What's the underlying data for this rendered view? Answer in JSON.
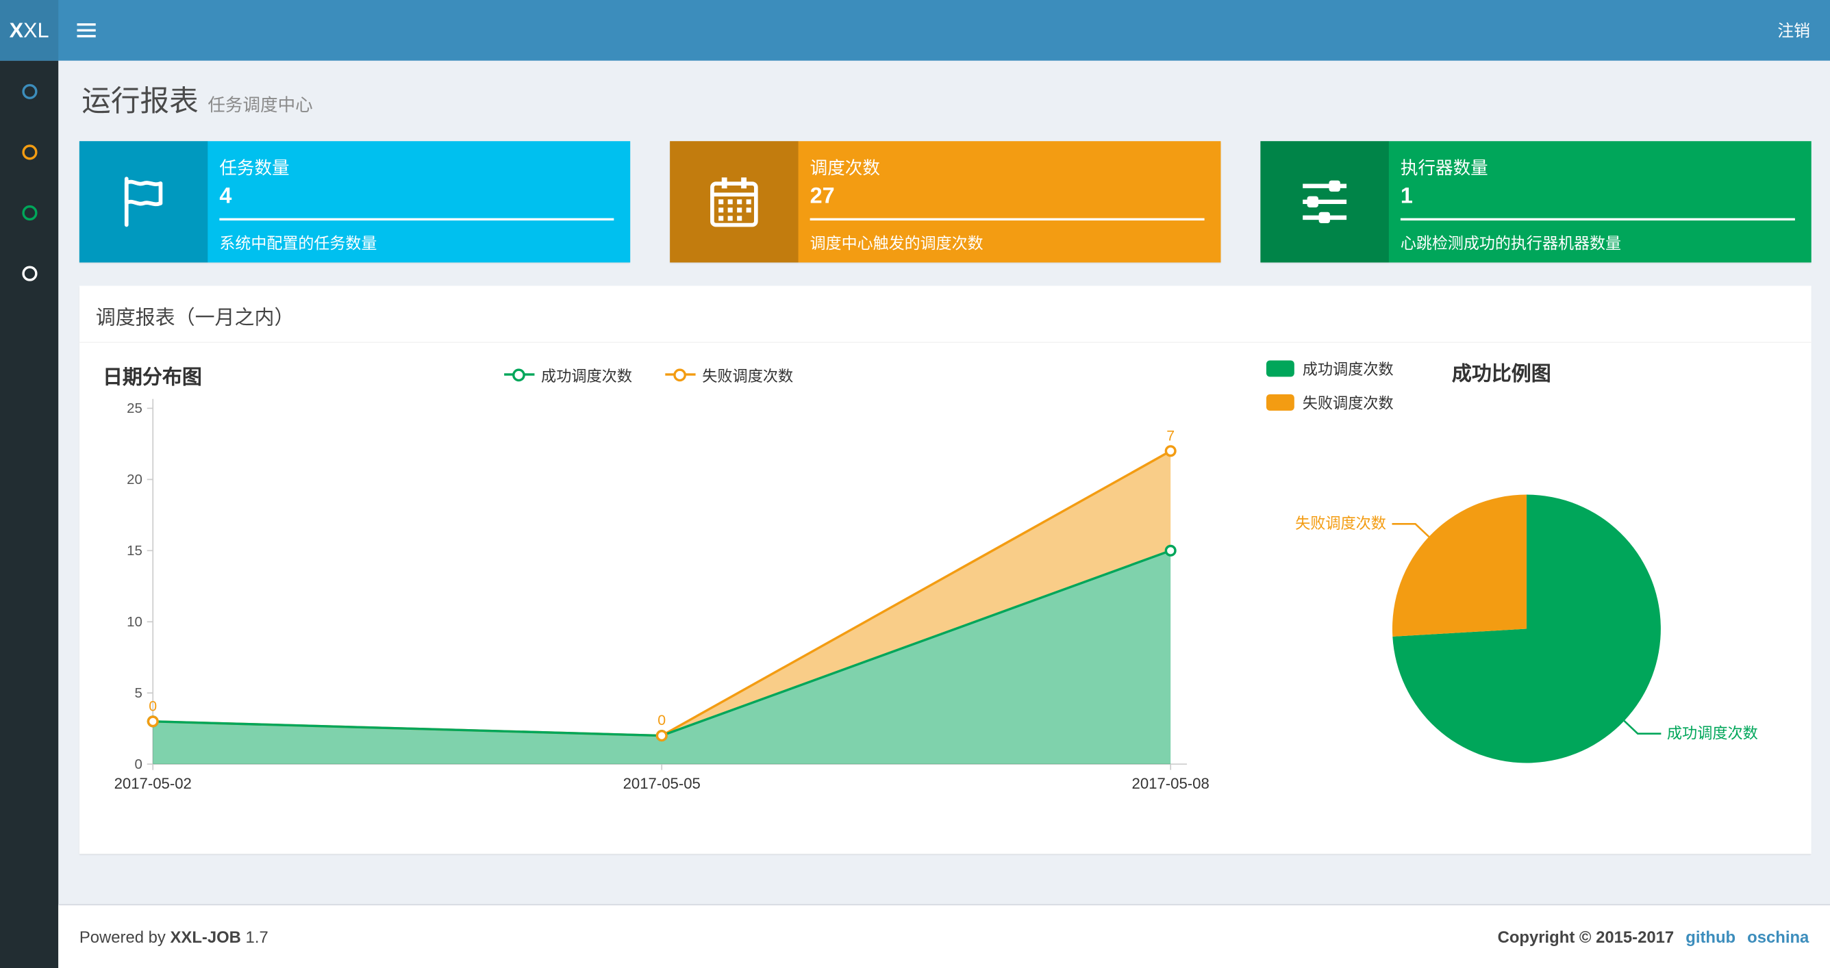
{
  "navbar": {
    "logo_bold": "X",
    "logo_rest": "XL",
    "logout_label": "注销"
  },
  "sidebar": {
    "items": [
      {
        "name": "menu-item-1",
        "color": "#3c8dbc"
      },
      {
        "name": "menu-item-2",
        "color": "#f39c12"
      },
      {
        "name": "menu-item-3",
        "color": "#00a65a"
      },
      {
        "name": "menu-item-4",
        "color": "#ffffff"
      }
    ]
  },
  "page_header": {
    "title": "运行报表",
    "subtitle": "任务调度中心"
  },
  "info_boxes": [
    {
      "icon": "flag-icon",
      "label": "任务数量",
      "value": "4",
      "description": "系统中配置的任务数量",
      "color": "#00c0ef"
    },
    {
      "icon": "calendar-icon",
      "label": "调度次数",
      "value": "27",
      "description": "调度中心触发的调度次数",
      "color": "#f39c12"
    },
    {
      "icon": "sliders-icon",
      "label": "执行器数量",
      "value": "1",
      "description": "心跳检测成功的执行器机器数量",
      "color": "#00a65a"
    }
  ],
  "panel": {
    "title": "调度报表（一月之内）"
  },
  "footer": {
    "powered_prefix": "Powered by",
    "product": "XXL-JOB",
    "version": "1.7",
    "copyright": "Copyright © 2015-2017",
    "links": [
      "github",
      "oschina"
    ]
  },
  "chart_data": [
    {
      "type": "area",
      "title": "日期分布图",
      "stacked": true,
      "x": [
        "2017-05-02",
        "2017-05-05",
        "2017-05-08"
      ],
      "series": [
        {
          "name": "成功调度次数",
          "color": "#00a65a",
          "values": [
            3,
            2,
            15
          ]
        },
        {
          "name": "失败调度次数",
          "color": "#f39c12",
          "values": [
            0,
            0,
            7
          ],
          "point_labels": [
            "0",
            "0",
            "7"
          ]
        }
      ],
      "xlabel": "",
      "ylabel": "",
      "ylim": [
        0,
        25
      ],
      "yticks": [
        0,
        5,
        10,
        15,
        20,
        25
      ],
      "grid": false,
      "legend_position": "top-center"
    },
    {
      "type": "pie",
      "title": "成功比例图",
      "slices": [
        {
          "name": "成功调度次数",
          "value": 20,
          "color": "#00a65a"
        },
        {
          "name": "失败调度次数",
          "value": 7,
          "color": "#f39c12"
        }
      ],
      "start_angle": "top",
      "direction": "clockwise",
      "legend_position": "top-left"
    }
  ]
}
